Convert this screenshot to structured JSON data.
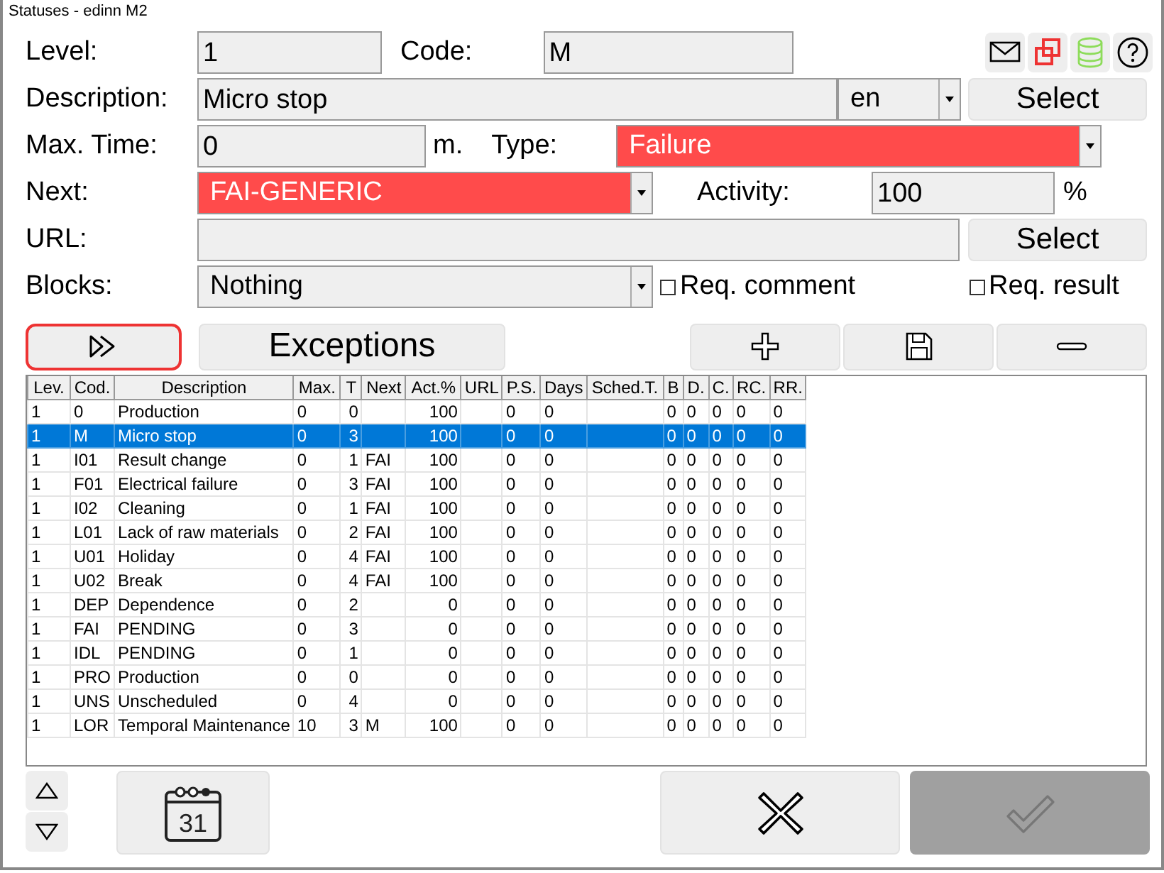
{
  "window": {
    "title": "Statuses - edinn M2"
  },
  "form": {
    "level": {
      "label": "Level:",
      "value": "1"
    },
    "code": {
      "label": "Code:",
      "value": "M"
    },
    "description": {
      "label": "Description:",
      "value": "Micro stop",
      "language": "en",
      "button": "Select"
    },
    "max_time": {
      "label": "Max. Time:",
      "value": "0",
      "unit": "m."
    },
    "type": {
      "label": "Type:",
      "value": "Failure",
      "color": "#ff4b4b"
    },
    "next": {
      "label": "Next:",
      "value": "FAI-GENERIC",
      "color": "#ff4b4b"
    },
    "activity": {
      "label": "Activity:",
      "value": "100",
      "unit": "%"
    },
    "url": {
      "label": "URL:",
      "button": "Select"
    },
    "blocks": {
      "label": "Blocks:",
      "value": "Nothing"
    },
    "req_comment": {
      "label": "Req. comment",
      "checked": false
    },
    "req_result": {
      "label": "Req. result",
      "checked": false
    }
  },
  "toolbar": {
    "next_button": {
      "focused": true
    },
    "exceptions_button": "Exceptions"
  },
  "table": {
    "columns": [
      "Lev.",
      "Cod.",
      "Description",
      "Max.",
      "T",
      "Next",
      "Act.%",
      "URL",
      "P.S.",
      "Days",
      "Sched.T.",
      "B",
      "D.",
      "C.",
      "RC.",
      "RR."
    ],
    "rows": [
      {
        "selected": false,
        "cells": [
          "1",
          "0",
          "Production",
          "0",
          "0",
          null,
          "100",
          null,
          "0",
          "0",
          null,
          "0",
          "0",
          "0",
          "0",
          "0"
        ]
      },
      {
        "selected": true,
        "cells": [
          "1",
          "M",
          "Micro stop",
          "0",
          "3",
          null,
          "100",
          null,
          "0",
          "0",
          null,
          "0",
          "0",
          "0",
          "0",
          "0"
        ]
      },
      {
        "selected": false,
        "cells": [
          "1",
          "I01",
          "Result change",
          "0",
          "1",
          "FAI",
          "100",
          null,
          "0",
          "0",
          null,
          "0",
          "0",
          "0",
          "0",
          "0"
        ]
      },
      {
        "selected": false,
        "cells": [
          "1",
          "F01",
          "Electrical failure",
          "0",
          "3",
          "FAI",
          "100",
          null,
          "0",
          "0",
          null,
          "0",
          "0",
          "0",
          "0",
          "0"
        ]
      },
      {
        "selected": false,
        "cells": [
          "1",
          "I02",
          "Cleaning",
          "0",
          "1",
          "FAI",
          "100",
          null,
          "0",
          "0",
          null,
          "0",
          "0",
          "0",
          "0",
          "0"
        ]
      },
      {
        "selected": false,
        "cells": [
          "1",
          "L01",
          "Lack of raw materials",
          "0",
          "2",
          "FAI",
          "100",
          null,
          "0",
          "0",
          null,
          "0",
          "0",
          "0",
          "0",
          "0"
        ]
      },
      {
        "selected": false,
        "cells": [
          "1",
          "U01",
          "Holiday",
          "0",
          "4",
          "FAI",
          "100",
          null,
          "0",
          "0",
          null,
          "0",
          "0",
          "0",
          "0",
          "0"
        ]
      },
      {
        "selected": false,
        "cells": [
          "1",
          "U02",
          "Break",
          "0",
          "4",
          "FAI",
          "100",
          null,
          "0",
          "0",
          null,
          "0",
          "0",
          "0",
          "0",
          "0"
        ]
      },
      {
        "selected": false,
        "cells": [
          "1",
          "DEP",
          "Dependence",
          "0",
          "2",
          null,
          "0",
          null,
          "0",
          "0",
          null,
          "0",
          "0",
          "0",
          "0",
          "0"
        ]
      },
      {
        "selected": false,
        "cells": [
          "1",
          "FAI",
          "PENDING",
          "0",
          "3",
          null,
          "0",
          null,
          "0",
          "0",
          null,
          "0",
          "0",
          "0",
          "0",
          "0"
        ]
      },
      {
        "selected": false,
        "cells": [
          "1",
          "IDL",
          "PENDING",
          "0",
          "1",
          null,
          "0",
          null,
          "0",
          "0",
          null,
          "0",
          "0",
          "0",
          "0",
          "0"
        ]
      },
      {
        "selected": false,
        "cells": [
          "1",
          "PRO",
          "Production",
          "0",
          "0",
          null,
          "0",
          null,
          "0",
          "0",
          null,
          "0",
          "0",
          "0",
          "0",
          "0"
        ]
      },
      {
        "selected": false,
        "cells": [
          "1",
          "UNS",
          "Unscheduled",
          "0",
          "4",
          null,
          "0",
          null,
          "0",
          "0",
          null,
          "0",
          "0",
          "0",
          "0",
          "0"
        ]
      },
      {
        "selected": false,
        "cells": [
          "1",
          "LOR",
          "Temporal Maintenance",
          "10",
          "3",
          "M",
          "100",
          null,
          "0",
          "0",
          null,
          "0",
          "0",
          "0",
          "0",
          "0"
        ]
      }
    ]
  },
  "footer": {
    "calendar_day": "31",
    "ok_button": {
      "disabled": true
    }
  }
}
